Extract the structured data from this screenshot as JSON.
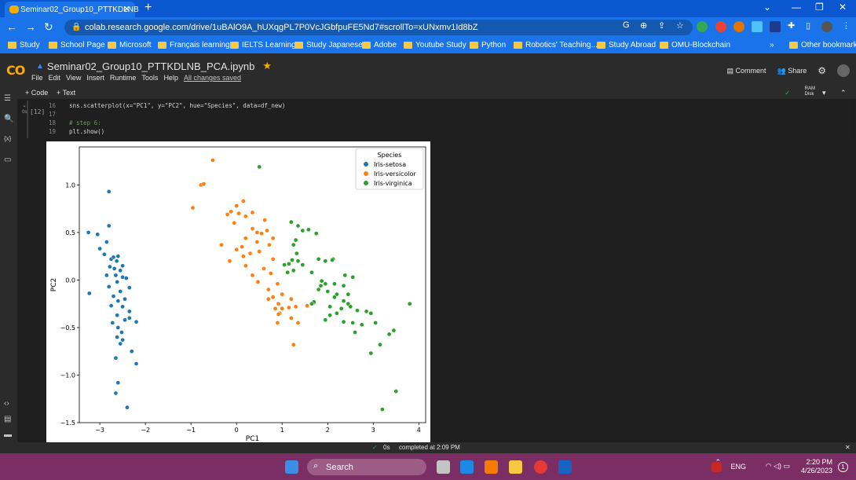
{
  "browser": {
    "tab_title": "Seminar02_Group10_PTTKDLNB",
    "url": "colab.research.google.com/drive/1uBAlO9A_hUXqgPL7P0VcJGbfpuFE5Nd7#scrollTo=xUNxmv1Id8bZ",
    "bookmarks": [
      "Study",
      "School Page",
      "Microsoft",
      "Français learning",
      "IELTS Learning",
      "Study Japanese",
      "Adobe",
      "Youtube Study",
      "Python",
      "Robotics' Teaching...",
      "Study Abroad",
      "OMU-Blockchain"
    ],
    "overflow": "»",
    "other_bookmarks": "Other bookmarks"
  },
  "colab": {
    "logo": "CO",
    "notebook_title": "Seminar02_Group10_PTTKDLNB_PCA.ipynb",
    "menus": [
      "File",
      "Edit",
      "View",
      "Insert",
      "Runtime",
      "Tools",
      "Help"
    ],
    "saved_status": "All changes saved",
    "comment_label": "Comment",
    "share_label": "Share",
    "add_code": "+ Code",
    "add_text": "+ Text",
    "ram_label": "RAM",
    "disk_label": "Disk",
    "exec_count": "[12]",
    "exec_time": "0s",
    "code_lines": [
      {
        "num": "16",
        "text": "sns.scatterplot(x=\"PC1\", y=\"PC2\", hue=\"Species\", data=df_new)"
      },
      {
        "num": "17",
        "text": ""
      },
      {
        "num": "18",
        "text": "# step 6:"
      },
      {
        "num": "19",
        "text": "plt.show()"
      }
    ],
    "status_time": "0s",
    "status_text": "completed at 2:09 PM"
  },
  "chart_data": {
    "type": "scatter",
    "xlabel": "PC1",
    "ylabel": "PC2",
    "xlim": [
      -3.45,
      4.15
    ],
    "ylim": [
      -1.5,
      1.4
    ],
    "xticks": [
      -3,
      -2,
      -1,
      0,
      1,
      2,
      3,
      4
    ],
    "yticks": [
      -1.5,
      -1.0,
      -0.5,
      0.0,
      0.5,
      1.0
    ],
    "legend_title": "Species",
    "legend_placement": "top-right",
    "series": [
      {
        "name": "Iris-setosa",
        "color": "#1f77b4",
        "points": [
          [
            -2.8,
            0.93
          ],
          [
            -3.25,
            0.5
          ],
          [
            -3.05,
            0.48
          ],
          [
            -2.8,
            0.57
          ],
          [
            -2.85,
            0.4
          ],
          [
            -3.0,
            0.33
          ],
          [
            -2.9,
            0.27
          ],
          [
            -2.75,
            0.22
          ],
          [
            -2.7,
            0.24
          ],
          [
            -2.63,
            0.2
          ],
          [
            -2.6,
            0.25
          ],
          [
            -2.5,
            0.15
          ],
          [
            -2.78,
            0.14
          ],
          [
            -2.68,
            0.12
          ],
          [
            -2.55,
            0.1
          ],
          [
            -2.85,
            0.05
          ],
          [
            -2.65,
            0.05
          ],
          [
            -2.5,
            0.03
          ],
          [
            -2.42,
            0.02
          ],
          [
            -2.62,
            -0.02
          ],
          [
            -2.8,
            -0.07
          ],
          [
            -2.35,
            -0.08
          ],
          [
            -2.55,
            -0.12
          ],
          [
            -3.23,
            -0.14
          ],
          [
            -2.7,
            -0.17
          ],
          [
            -2.45,
            -0.2
          ],
          [
            -2.6,
            -0.22
          ],
          [
            -2.75,
            -0.27
          ],
          [
            -2.5,
            -0.28
          ],
          [
            -2.35,
            -0.33
          ],
          [
            -2.62,
            -0.37
          ],
          [
            -2.45,
            -0.42
          ],
          [
            -2.35,
            -0.4
          ],
          [
            -2.72,
            -0.45
          ],
          [
            -2.2,
            -0.44
          ],
          [
            -2.6,
            -0.5
          ],
          [
            -2.52,
            -0.55
          ],
          [
            -2.62,
            -0.6
          ],
          [
            -2.5,
            -0.63
          ],
          [
            -2.55,
            -0.67
          ],
          [
            -2.3,
            -0.75
          ],
          [
            -2.65,
            -0.82
          ],
          [
            -2.2,
            -0.88
          ],
          [
            -2.6,
            -1.08
          ],
          [
            -2.65,
            -1.19
          ],
          [
            -2.4,
            -1.34
          ]
        ]
      },
      {
        "name": "Iris-versicolor",
        "color": "#ff7f0e",
        "points": [
          [
            -0.52,
            1.26
          ],
          [
            -0.78,
            1.0
          ],
          [
            -0.72,
            1.01
          ],
          [
            -0.96,
            0.76
          ],
          [
            0.0,
            0.78
          ],
          [
            0.15,
            0.83
          ],
          [
            0.35,
            0.71
          ],
          [
            -0.2,
            0.69
          ],
          [
            -0.12,
            0.72
          ],
          [
            0.05,
            0.7
          ],
          [
            0.2,
            0.67
          ],
          [
            0.62,
            0.63
          ],
          [
            -0.05,
            0.6
          ],
          [
            0.35,
            0.54
          ],
          [
            0.45,
            0.5
          ],
          [
            0.55,
            0.49
          ],
          [
            0.67,
            0.52
          ],
          [
            0.8,
            0.44
          ],
          [
            0.2,
            0.44
          ],
          [
            0.45,
            0.4
          ],
          [
            0.72,
            0.37
          ],
          [
            -0.33,
            0.37
          ],
          [
            0.0,
            0.32
          ],
          [
            0.12,
            0.35
          ],
          [
            0.3,
            0.28
          ],
          [
            0.15,
            0.25
          ],
          [
            0.5,
            0.3
          ],
          [
            0.8,
            0.22
          ],
          [
            -0.15,
            0.2
          ],
          [
            0.2,
            0.15
          ],
          [
            0.6,
            0.12
          ],
          [
            0.75,
            0.07
          ],
          [
            0.35,
            0.05
          ],
          [
            0.47,
            -0.02
          ],
          [
            0.9,
            -0.04
          ],
          [
            0.7,
            -0.1
          ],
          [
            1.0,
            -0.15
          ],
          [
            0.8,
            -0.18
          ],
          [
            0.7,
            -0.2
          ],
          [
            1.2,
            -0.2
          ],
          [
            0.92,
            -0.25
          ],
          [
            1.0,
            -0.3
          ],
          [
            1.15,
            -0.29
          ],
          [
            0.85,
            -0.3
          ],
          [
            1.3,
            -0.28
          ],
          [
            0.95,
            -0.35
          ],
          [
            1.55,
            -0.27
          ],
          [
            1.7,
            -0.24
          ],
          [
            0.9,
            -0.45
          ],
          [
            1.2,
            -0.4
          ],
          [
            1.35,
            -0.45
          ],
          [
            1.25,
            -0.68
          ],
          [
            0.92,
            -0.36
          ]
        ]
      },
      {
        "name": "Iris-virginica",
        "color": "#2ca02c",
        "points": [
          [
            0.5,
            1.19
          ],
          [
            1.2,
            0.61
          ],
          [
            1.35,
            0.57
          ],
          [
            1.45,
            0.52
          ],
          [
            1.58,
            0.53
          ],
          [
            1.75,
            0.49
          ],
          [
            1.3,
            0.42
          ],
          [
            1.25,
            0.37
          ],
          [
            1.32,
            0.28
          ],
          [
            1.22,
            0.21
          ],
          [
            1.35,
            0.2
          ],
          [
            1.15,
            0.17
          ],
          [
            1.45,
            0.16
          ],
          [
            1.05,
            0.16
          ],
          [
            1.25,
            0.1
          ],
          [
            1.12,
            0.08
          ],
          [
            1.8,
            0.22
          ],
          [
            2.12,
            0.22
          ],
          [
            2.1,
            0.21
          ],
          [
            2.38,
            0.05
          ],
          [
            2.55,
            0.03
          ],
          [
            1.95,
            0.2
          ],
          [
            1.65,
            0.08
          ],
          [
            1.87,
            -0.01
          ],
          [
            1.95,
            -0.04
          ],
          [
            1.85,
            -0.06
          ],
          [
            2.15,
            -0.04
          ],
          [
            2.35,
            -0.06
          ],
          [
            1.8,
            -0.1
          ],
          [
            2.0,
            -0.12
          ],
          [
            2.2,
            -0.15
          ],
          [
            2.15,
            -0.18
          ],
          [
            2.45,
            -0.15
          ],
          [
            2.35,
            -0.22
          ],
          [
            1.7,
            -0.23
          ],
          [
            2.45,
            -0.25
          ],
          [
            1.65,
            -0.25
          ],
          [
            2.05,
            -0.28
          ],
          [
            2.3,
            -0.3
          ],
          [
            2.5,
            -0.28
          ],
          [
            2.65,
            -0.32
          ],
          [
            2.85,
            -0.33
          ],
          [
            2.95,
            -0.35
          ],
          [
            2.2,
            -0.35
          ],
          [
            2.05,
            -0.37
          ],
          [
            1.95,
            -0.42
          ],
          [
            2.35,
            -0.44
          ],
          [
            2.55,
            -0.45
          ],
          [
            3.05,
            -0.45
          ],
          [
            2.75,
            -0.47
          ],
          [
            3.8,
            -0.25
          ],
          [
            2.6,
            -0.55
          ],
          [
            3.45,
            -0.53
          ],
          [
            3.35,
            -0.57
          ],
          [
            3.15,
            -0.68
          ],
          [
            2.95,
            -0.77
          ],
          [
            3.5,
            -1.17
          ],
          [
            3.2,
            -1.36
          ]
        ]
      }
    ]
  },
  "taskbar": {
    "search_label": "Search",
    "lang": "ENG",
    "time": "2:20 PM",
    "date": "4/26/2023",
    "notification_count": "1"
  }
}
